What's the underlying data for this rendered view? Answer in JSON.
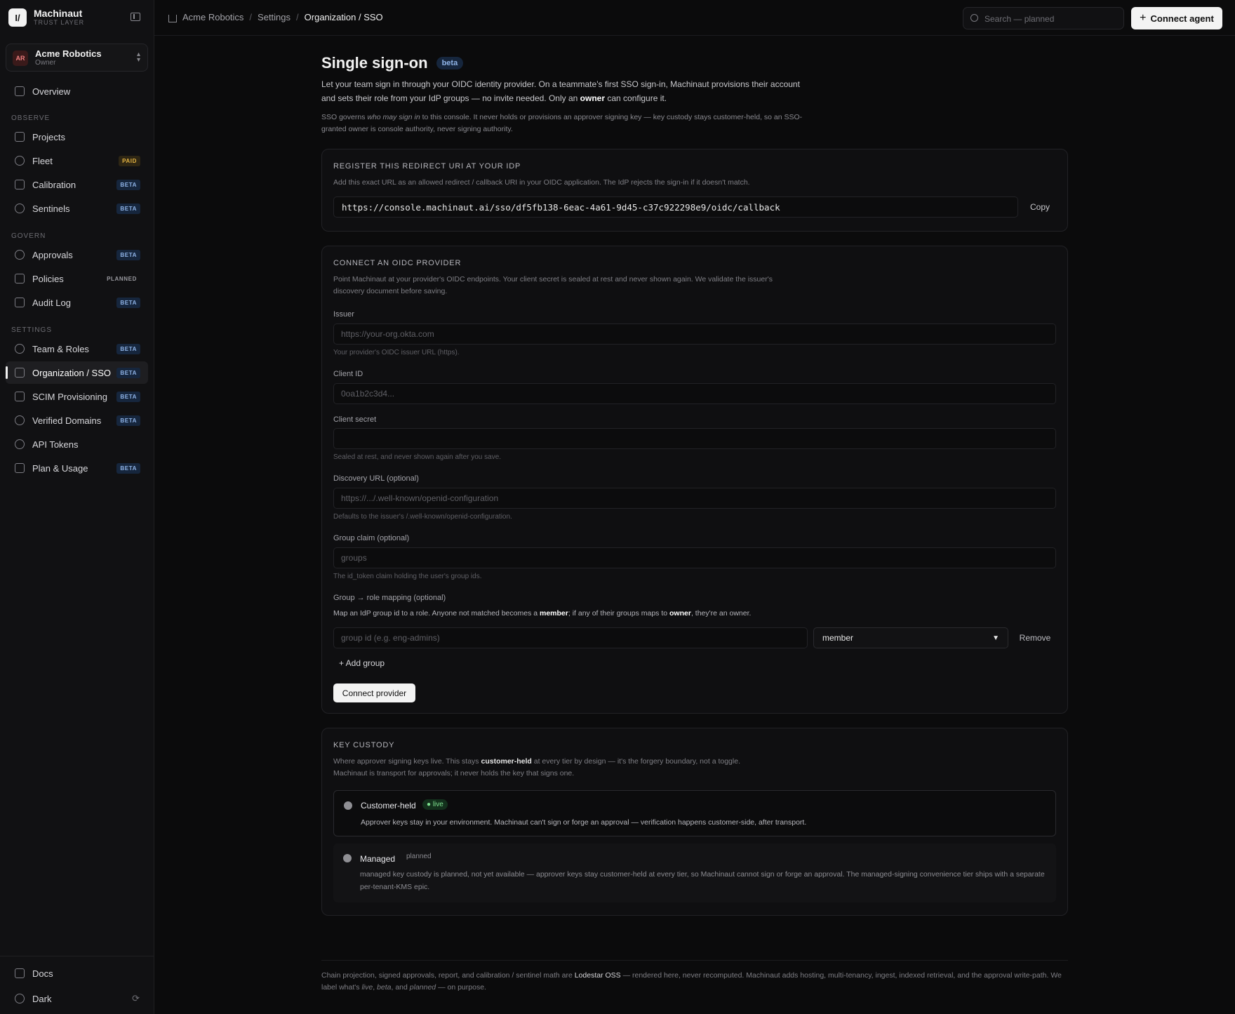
{
  "app": {
    "name": "Machinaut",
    "subtitle": "TRUST LAYER",
    "logo_glyph": "I/"
  },
  "org": {
    "initials": "AR",
    "name": "Acme Robotics",
    "role": "Owner"
  },
  "sidebar": {
    "overview": {
      "label": "Overview"
    },
    "sections": {
      "observe": "OBSERVE",
      "govern": "GOVERN",
      "settings": "SETTINGS"
    },
    "items": [
      {
        "label": "Projects",
        "badge": ""
      },
      {
        "label": "Fleet",
        "badge": "PAID"
      },
      {
        "label": "Calibration",
        "badge": "BETA"
      },
      {
        "label": "Sentinels",
        "badge": "BETA"
      },
      {
        "label": "Approvals",
        "badge": "BETA"
      },
      {
        "label": "Policies",
        "badge": "PLANNED"
      },
      {
        "label": "Audit Log",
        "badge": "BETA"
      },
      {
        "label": "Team & Roles",
        "badge": "BETA"
      },
      {
        "label": "Organization / SSO",
        "badge": "BETA"
      },
      {
        "label": "SCIM Provisioning",
        "badge": "BETA"
      },
      {
        "label": "Verified Domains",
        "badge": "BETA"
      },
      {
        "label": "API Tokens",
        "badge": ""
      },
      {
        "label": "Plan & Usage",
        "badge": "BETA"
      }
    ],
    "active": "Organization / SSO",
    "bottom": {
      "docs": "Docs",
      "theme": "Dark"
    }
  },
  "breadcrumb": [
    "Acme Robotics",
    "Settings",
    "Organization / SSO"
  ],
  "search": {
    "placeholder": "Search — planned"
  },
  "topbar": {
    "connect_label": "Connect agent"
  },
  "page": {
    "title": "Single sign-on",
    "title_badge": "beta",
    "intro_a": "Let your team sign in through your OIDC identity provider. On a teammate's first SSO sign-in, Machinaut provisions their account and sets their role from your IdP groups — no invite needed. Only an ",
    "intro_owner": "owner",
    "intro_b": " can configure it.",
    "note_a": "SSO governs ",
    "note_em": "who may sign in",
    "note_b": " to this console. It never holds or provisions an approver signing key — key custody stays customer-held, so an SSO-granted owner is console authority, never signing authority."
  },
  "redirect": {
    "heading": "REGISTER THIS REDIRECT URI AT YOUR IDP",
    "desc": "Add this exact URL as an allowed redirect / callback URI in your OIDC application. The IdP rejects the sign-in if it doesn't match.",
    "uri": "https://console.machinaut.ai/sso/df5fb138-6eac-4a61-9d45-c37c922298e9/oidc/callback",
    "copy_label": "Copy"
  },
  "oidc": {
    "heading": "CONNECT AN OIDC PROVIDER",
    "desc": "Point Machinaut at your provider's OIDC endpoints. Your client secret is sealed at rest and never shown again. We validate the issuer's discovery document before saving.",
    "issuer": {
      "label": "Issuer",
      "placeholder": "https://your-org.okta.com",
      "help": "Your provider's OIDC issuer URL (https)."
    },
    "client_id": {
      "label": "Client ID",
      "placeholder": "0oa1b2c3d4..."
    },
    "client_secret": {
      "label": "Client secret",
      "placeholder": "",
      "help": "Sealed at rest, and never shown again after you save."
    },
    "discovery": {
      "label": "Discovery URL (optional)",
      "placeholder": "https://.../.well-known/openid-configuration",
      "help": "Defaults to the issuer's /.well-known/openid-configuration."
    },
    "group_claim": {
      "label": "Group claim (optional)",
      "placeholder": "groups",
      "help": "The id_token claim holding the user's group ids."
    },
    "mapping": {
      "label": "Group → role mapping (optional)",
      "hint_a": "Map an IdP group id to a role. Anyone not matched becomes a ",
      "hint_member": "member",
      "hint_b": "; if any of their groups maps to ",
      "hint_owner": "owner",
      "hint_c": ", they're an owner.",
      "group_placeholder": "group id (e.g. eng-admins)",
      "role_value": "member",
      "remove_label": "Remove",
      "add_label": "+ Add group"
    },
    "submit_label": "Connect provider"
  },
  "custody": {
    "heading": "KEY CUSTODY",
    "desc_a": "Where approver signing keys live. This stays ",
    "desc_bold": "customer-held",
    "desc_b": " at every tier by design — it's the forgery boundary, not a toggle.",
    "desc_c": "Machinaut is transport for approvals; it never holds the key that signs one.",
    "options": [
      {
        "title": "Customer-held",
        "tag": "live",
        "desc": "Approver keys stay in your environment. Machinaut can't sign or forge an approval — verification happens customer-side, after transport."
      },
      {
        "title": "Managed",
        "tag": "planned",
        "desc": "managed key custody is planned, not yet available — approver keys stay customer-held at every tier, so Machinaut cannot sign or forge an approval. The managed-signing convenience tier ships with a separate per-tenant-KMS epic."
      }
    ]
  },
  "footer": {
    "a": "Chain projection, signed approvals, report, and calibration / sentinel math are ",
    "link": "Lodestar OSS",
    "b": " — rendered here, never recomputed. Machinaut adds hosting, multi-tenancy, ingest, indexed retrieval, and the approval write-path. We label what's ",
    "live": "live",
    "comma1": ", ",
    "beta": "beta",
    "and": ", and ",
    "planned": "planned",
    "c": " — on purpose."
  }
}
